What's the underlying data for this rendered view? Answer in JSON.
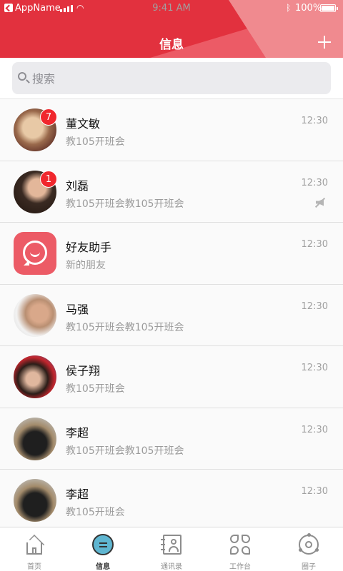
{
  "status_bar": {
    "app_name": "AppName",
    "time": "9:41 AM",
    "battery": "100%"
  },
  "header": {
    "title": "信息",
    "add_icon": "plus-icon",
    "colors": {
      "primary": "#e2313e",
      "accent": "#ec5b66",
      "light": "#f08a8f"
    }
  },
  "search": {
    "placeholder": "搜索",
    "value": ""
  },
  "conversations": [
    {
      "name": "董文敏",
      "message": "教105开班会",
      "time": "12:30",
      "badge": "7",
      "muted": false,
      "avatar": "photo"
    },
    {
      "name": "刘磊",
      "message": "教105开班会教105开班会",
      "time": "12:30",
      "badge": "1",
      "muted": true,
      "avatar": "photo"
    },
    {
      "name": "好友助手",
      "message": "新的朋友",
      "time": "12:30",
      "badge": "",
      "muted": false,
      "avatar": "chat-bubble-icon"
    },
    {
      "name": "马强",
      "message": "教105开班会教105开班会",
      "time": "12:30",
      "badge": "",
      "muted": false,
      "avatar": "photo"
    },
    {
      "name": "侯子翔",
      "message": "教105开班会",
      "time": "12:30",
      "badge": "",
      "muted": false,
      "avatar": "photo"
    },
    {
      "name": "李超",
      "message": "教105开班会教105开班会",
      "time": "12:30",
      "badge": "",
      "muted": false,
      "avatar": "photo"
    },
    {
      "name": "李超",
      "message": "教105开班会",
      "time": "12:30",
      "badge": "",
      "muted": false,
      "avatar": "photo"
    }
  ],
  "tabs": [
    {
      "label": "首页",
      "icon": "home-icon",
      "active": false
    },
    {
      "label": "信息",
      "icon": "message-icon",
      "active": true
    },
    {
      "label": "通讯录",
      "icon": "contacts-icon",
      "active": false
    },
    {
      "label": "工作台",
      "icon": "workbench-icon",
      "active": false
    },
    {
      "label": "圈子",
      "icon": "circle-icon",
      "active": false
    }
  ]
}
